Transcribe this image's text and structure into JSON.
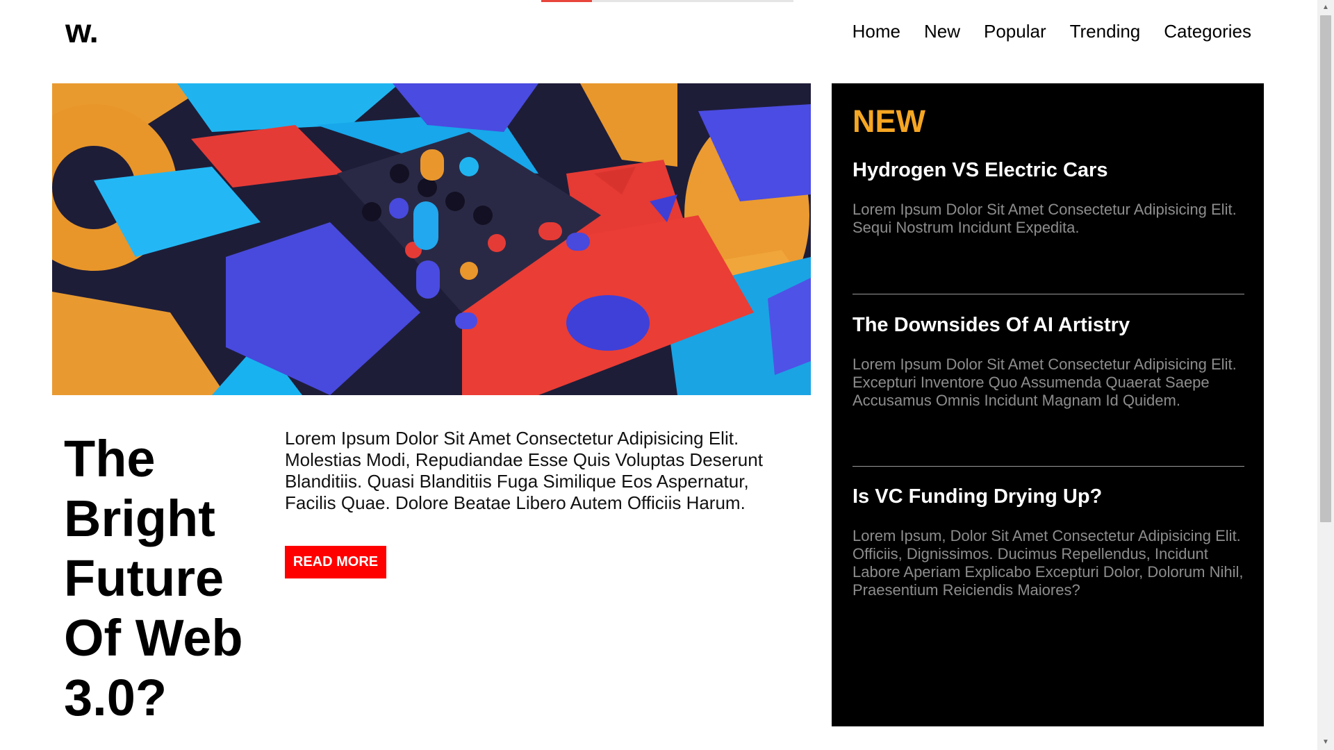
{
  "progress": {
    "fraction": 0.2
  },
  "header": {
    "logo": "w.",
    "nav": [
      "Home",
      "New",
      "Popular",
      "Trending",
      "Categories"
    ]
  },
  "main": {
    "hero_alt": "Colorful 3D geometric blocks",
    "headline": "The Bright Future Of Web 3.0?",
    "excerpt": "Lorem Ipsum Dolor Sit Amet Consectetur Adipisicing Elit. Molestias Modi, Repudiandae Esse Quis Voluptas Deserunt Blanditiis. Quasi Blanditiis Fuga Similique Eos Aspernatur, Facilis Quae. Dolore Beatae Libero Autem Officiis Harum.",
    "read_more": "READ MORE"
  },
  "new_panel": {
    "title": "NEW",
    "items": [
      {
        "title": "Hydrogen VS Electric Cars",
        "text": "Lorem Ipsum Dolor Sit Amet Consectetur Adipisicing Elit. Sequi Nostrum Incidunt Expedita."
      },
      {
        "title": "The Downsides Of AI Artistry",
        "text": "Lorem Ipsum Dolor Sit Amet Consectetur Adipisicing Elit. Excepturi Inventore Quo Assumenda Quaerat Saepe Accusamus Omnis Incidunt Magnam Id Quidem."
      },
      {
        "title": "Is VC Funding Drying Up?",
        "text": "Lorem Ipsum, Dolor Sit Amet Consectetur Adipisicing Elit. Officiis, Dignissimos. Ducimus Repellendus, Incidunt Labore Aperiam Explicabo Excepturi Dolor, Dolorum Nihil, Praesentium Reiciendis Maiores?"
      }
    ]
  },
  "colors": {
    "accent_red": "#ff0000",
    "new_orange": "#f5a623",
    "panel_bg": "#000000",
    "muted_text": "#8d8d8d"
  },
  "icons": {
    "scroll_up": "triangle-up-icon",
    "scroll_down": "triangle-down-icon"
  }
}
